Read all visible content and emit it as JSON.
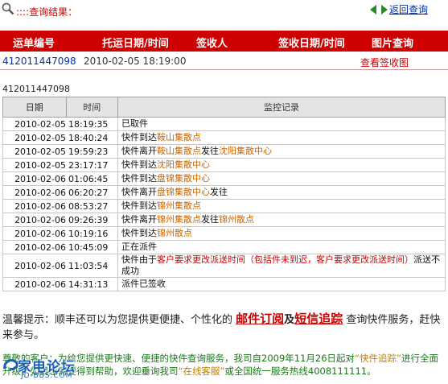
{
  "header": {
    "result_label": "::::查询结果：",
    "back_label": "返回查询",
    "back_sep": ":::"
  },
  "summary": {
    "columns": [
      "运单编号",
      "托运日期/时间",
      "签收人",
      "签收日期/时间",
      "图片查询"
    ],
    "row": {
      "waybill": "412011447098",
      "ship_datetime": "2010-02-05 18:19:00",
      "signer": "",
      "sign_datetime": "",
      "image_link": "查看签收图"
    }
  },
  "tracking": {
    "waybill": "412011447098",
    "columns": [
      "日期",
      "时间",
      "监控记录"
    ],
    "rows": [
      {
        "date": "2010-02-05",
        "time": "18:19:35",
        "parts": [
          {
            "t": "已取件",
            "c": ""
          }
        ]
      },
      {
        "date": "2010-02-05",
        "time": "18:40:24",
        "parts": [
          {
            "t": "快件到达",
            "c": ""
          },
          {
            "t": "鞍山集散点",
            "c": "loc"
          }
        ]
      },
      {
        "date": "2010-02-05",
        "time": "19:59:23",
        "parts": [
          {
            "t": "快件离开",
            "c": ""
          },
          {
            "t": "鞍山集散点",
            "c": "loc"
          },
          {
            "t": "发往",
            "c": ""
          },
          {
            "t": "沈阳集散中心",
            "c": "loc"
          }
        ]
      },
      {
        "date": "2010-02-05",
        "time": "23:17:17",
        "parts": [
          {
            "t": "快件到达",
            "c": ""
          },
          {
            "t": "沈阳集散中心",
            "c": "loc"
          }
        ]
      },
      {
        "date": "2010-02-06",
        "time": "01:06:45",
        "parts": [
          {
            "t": "快件到达",
            "c": ""
          },
          {
            "t": "盘锦集散中心",
            "c": "loc"
          }
        ]
      },
      {
        "date": "2010-02-06",
        "time": "06:20:27",
        "parts": [
          {
            "t": "快件离开",
            "c": ""
          },
          {
            "t": "盘锦集散中心",
            "c": "loc"
          },
          {
            "t": "发往",
            "c": ""
          }
        ]
      },
      {
        "date": "2010-02-06",
        "time": "08:53:27",
        "parts": [
          {
            "t": "快件到达",
            "c": ""
          },
          {
            "t": "锦州集散点",
            "c": "loc"
          }
        ]
      },
      {
        "date": "2010-02-06",
        "time": "09:26:39",
        "parts": [
          {
            "t": "快件离开",
            "c": ""
          },
          {
            "t": "锦州集散点",
            "c": "loc"
          },
          {
            "t": "发往",
            "c": ""
          },
          {
            "t": "锦州散点",
            "c": "loc"
          }
        ]
      },
      {
        "date": "2010-02-06",
        "time": "10:19:16",
        "parts": [
          {
            "t": "快件到达",
            "c": ""
          },
          {
            "t": "锦州散点",
            "c": "loc"
          }
        ]
      },
      {
        "date": "2010-02-06",
        "time": "10:45:09",
        "parts": [
          {
            "t": "正在派件",
            "c": ""
          }
        ]
      },
      {
        "date": "2010-02-06",
        "time": "11:03:54",
        "parts": [
          {
            "t": "快件由于",
            "c": ""
          },
          {
            "t": "客户要求更改派送时间（包括件未到迟，客户要求更改派送时间）",
            "c": "red"
          },
          {
            "t": "派送不成功",
            "c": ""
          }
        ]
      },
      {
        "date": "2010-02-06",
        "time": "14:31:13",
        "parts": [
          {
            "t": "派件已签收",
            "c": ""
          }
        ]
      }
    ]
  },
  "tip": {
    "prefix": "温馨提示：顺丰还可以为您提供更便捷、个性化的",
    "link1": "邮件订阅",
    "conj": "及",
    "link2": "短信追踪",
    "suffix": "查询快件服务，赶快来参与。"
  },
  "notice": {
    "lead": "尊敬的客户：为给您提供更快速、便捷的快件查询服务，我司自2009年11月26日起对",
    "q1": "“快件追踪”",
    "mid": "进行全面升级，如果您需要得到帮助，欢迎垂询我司",
    "q2": "“在线客服”",
    "tail": "或全国统一服务热线4008111111。"
  },
  "watermark": {
    "title": "家电论坛",
    "sub": "JD-BBS.COM"
  },
  "colors": {
    "header_red": "#cf0000",
    "location_orange": "#cc6600",
    "link_blue": "#0033aa",
    "notice_green": "#1a7a1a"
  }
}
